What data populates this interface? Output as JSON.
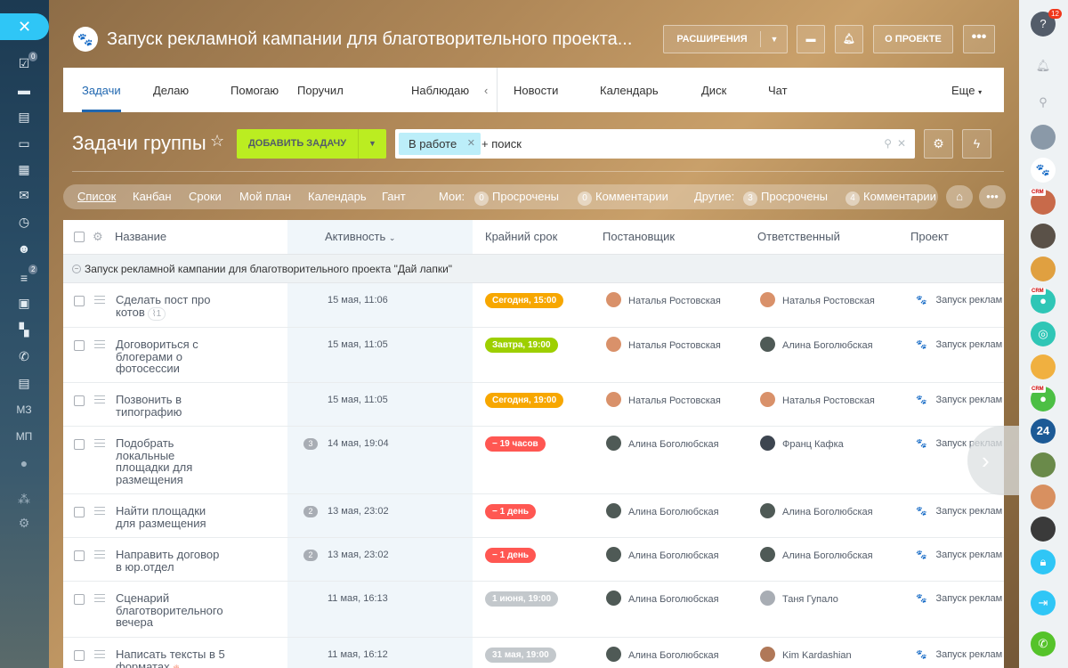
{
  "project": {
    "title": "Запуск рекламной кампании для благотворительного проекта...",
    "avatar_icon": "paw-icon"
  },
  "header_buttons": {
    "extensions": "РАСШИРЕНИЯ",
    "about": "О ПРОЕКТЕ"
  },
  "tabs": [
    "Задачи",
    "Делаю",
    "Помогаю",
    "Поручил",
    "Наблюдаю",
    "Новости",
    "Календарь",
    "Диск",
    "Чат"
  ],
  "tabs_more": "Еще",
  "page_title": "Задачи группы",
  "add_task_label": "ДОБАВИТЬ ЗАДАЧУ",
  "search": {
    "chip": "В работе",
    "placeholder": "+ поиск"
  },
  "views": [
    "Список",
    "Канбан",
    "Сроки",
    "Мой план",
    "Календарь",
    "Гант"
  ],
  "counters": {
    "mine_label": "Мои:",
    "mine_overdue": "0",
    "mine_overdue_label": "Просрочены",
    "mine_comments": "0",
    "mine_comments_label": "Комментарии",
    "others_label": "Другие:",
    "others_overdue": "3",
    "others_overdue_label": "Просрочены",
    "others_comments": "4",
    "others_comments_label": "Комментарии"
  },
  "columns": {
    "name": "Название",
    "activity": "Активность",
    "deadline": "Крайний срок",
    "creator": "Постановщик",
    "responsible": "Ответственный",
    "project": "Проект"
  },
  "group_title": "Запуск рекламной кампании для благотворительного проекта \"Дай лапки\"",
  "rows": [
    {
      "name": "Сделать пост про котов",
      "clip": "1",
      "count": "",
      "activity": "15 мая, 11:06",
      "deadline": "Сегодня, 15:00",
      "deadline_color": "#f7a700",
      "creator": "Наталья Ростовская",
      "responsible": "Наталья Ростовская",
      "project": "Запуск реклам"
    },
    {
      "name": "Договориться с блогерами о фотосессии",
      "clip": "",
      "count": "",
      "activity": "15 мая, 11:05",
      "deadline": "Завтра, 19:00",
      "deadline_color": "#9dcf00",
      "creator": "Наталья Ростовская",
      "responsible": "Алина Боголюбская",
      "project": "Запуск реклам"
    },
    {
      "name": "Позвонить в типографию",
      "clip": "",
      "count": "",
      "activity": "15 мая, 11:05",
      "deadline": "Сегодня, 19:00",
      "deadline_color": "#f7a700",
      "creator": "Наталья Ростовская",
      "responsible": "Наталья Ростовская",
      "project": "Запуск реклам"
    },
    {
      "name": "Подобрать локальные площадки для размещения",
      "clip": "",
      "count": "3",
      "activity": "14 мая, 19:04",
      "deadline": "− 19 часов",
      "deadline_color": "#ff5752",
      "creator": "Алина Боголюбская",
      "responsible": "Франц Кафка",
      "project": "Запуск реклам"
    },
    {
      "name": "Найти площадки для размещения",
      "clip": "",
      "count": "2",
      "activity": "13 мая, 23:02",
      "deadline": "− 1 день",
      "deadline_color": "#ff5752",
      "creator": "Алина Боголюбская",
      "responsible": "Алина Боголюбская",
      "project": "Запуск реклам"
    },
    {
      "name": "Направить договор в юр.отдел",
      "clip": "",
      "count": "2",
      "activity": "13 мая, 23:02",
      "deadline": "− 1 день",
      "deadline_color": "#ff5752",
      "creator": "Алина Боголюбская",
      "responsible": "Алина Боголюбская",
      "project": "Запуск реклам"
    },
    {
      "name": "Сценарий благотворительного вечера",
      "clip": "",
      "count": "",
      "activity": "11 мая, 16:13",
      "deadline": "1 июня, 19:00",
      "deadline_color": "#c3c8cc",
      "creator": "Алина Боголюбская",
      "responsible": "Таня Гупало",
      "project": "Запуск реклам"
    },
    {
      "name": "Написать тексты в 5 форматах",
      "clip": "",
      "count": "",
      "activity": "11 мая, 16:12",
      "deadline": "31 мая, 19:00",
      "deadline_color": "#c3c8cc",
      "creator": "Алина Боголюбская",
      "responsible": "Kim Kardashian",
      "project": "Запуск реклам"
    }
  ],
  "leftnav": {
    "mz": "МЗ",
    "mp": "МП",
    "badge_tasks": "0",
    "badge_filter": "2"
  },
  "rightrail": {
    "help_badge": "12",
    "b24": "24"
  }
}
